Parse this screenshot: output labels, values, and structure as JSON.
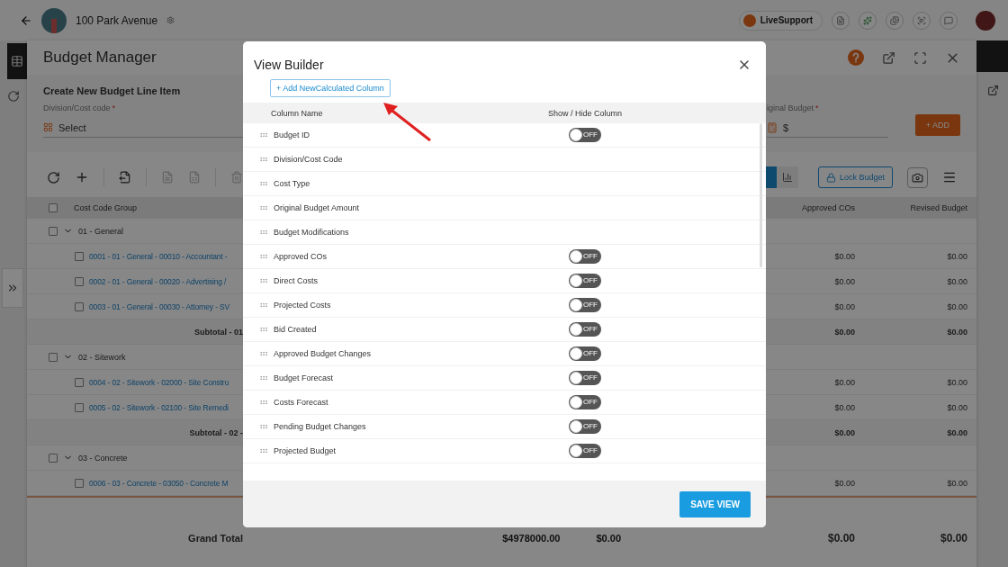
{
  "top_bar": {
    "project": "100 Park Avenue",
    "live_support": "LiveSupport"
  },
  "panel": {
    "title": "Budget Manager"
  },
  "create_form": {
    "title": "Create New Budget Line Item",
    "division_label": "Division/Cost code",
    "division_required": "*",
    "division_placeholder": "Select",
    "budget_label": "iginal Budget",
    "budget_required": "*",
    "budget_prefix": "$",
    "add_button": "+ ADD"
  },
  "toolbar": {
    "lock_button": "Lock Budget"
  },
  "table": {
    "select_all_checked": false,
    "columns": [
      "Cost Code Group",
      "Approved COs",
      "Revised Budget"
    ],
    "rows": [
      {
        "kind": "group",
        "label": "01 - General",
        "checked": false,
        "expanded": true
      },
      {
        "kind": "item",
        "label": "0001 - 01 - General - 00010 - Accountant -",
        "checked": false,
        "values": [
          "$0.00",
          "$0.00"
        ]
      },
      {
        "kind": "item",
        "label": "0002 - 01 - General - 00020 - Advertising /",
        "checked": false,
        "values": [
          "$0.00",
          "$0.00"
        ]
      },
      {
        "kind": "item",
        "label": "0003 - 01 - General - 00030 - Attorney - SV",
        "checked": false,
        "values": [
          "$0.00",
          "$0.00"
        ]
      },
      {
        "kind": "subtotal",
        "label": "Subtotal - 01",
        "values": [
          "$0.00",
          "$0.00"
        ]
      },
      {
        "kind": "group",
        "label": "02 - Sitework",
        "checked": false,
        "expanded": true
      },
      {
        "kind": "item",
        "label": "0004 - 02 - Sitework - 02000 - Site Constru",
        "checked": false,
        "values": [
          "$0.00",
          "$0.00"
        ]
      },
      {
        "kind": "item",
        "label": "0005 - 02 - Sitework - 02100 - Site Remedi",
        "checked": false,
        "values": [
          "$0.00",
          "$0.00"
        ]
      },
      {
        "kind": "subtotal",
        "label": "Subtotal - 02 -",
        "values": [
          "$0.00",
          "$0.00"
        ]
      },
      {
        "kind": "group",
        "label": "03 - Concrete",
        "checked": false,
        "expanded": true
      },
      {
        "kind": "item",
        "label": "0006 - 03 - Concrete - 03050 - Concrete M",
        "checked": false,
        "values": [
          "$0.00",
          "$0.00"
        ]
      }
    ],
    "grand_total": {
      "label": "Grand Total",
      "middle_values": [
        "$4978000.00",
        "$0.00"
      ],
      "values": [
        "$0.00",
        "$0.00"
      ]
    }
  },
  "dialog": {
    "title": "View Builder",
    "add_button": "+ Add NewCalculated Column",
    "headers": [
      "Column Name",
      "Show / Hide Column"
    ],
    "columns": [
      {
        "name": "Budget ID",
        "toggle": {
          "on": false,
          "label": "OFF"
        }
      },
      {
        "name": "Division/Cost Code"
      },
      {
        "name": "Cost Type"
      },
      {
        "name": "Original Budget Amount"
      },
      {
        "name": "Budget Modifications"
      },
      {
        "name": "Approved COs",
        "toggle": {
          "on": false,
          "label": "OFF"
        }
      },
      {
        "name": "Direct Costs",
        "toggle": {
          "on": false,
          "label": "OFF"
        }
      },
      {
        "name": "Projected Costs",
        "toggle": {
          "on": false,
          "label": "OFF"
        }
      },
      {
        "name": "Bid Created",
        "toggle": {
          "on": false,
          "label": "OFF"
        }
      },
      {
        "name": "Approved Budget Changes",
        "toggle": {
          "on": false,
          "label": "OFF"
        }
      },
      {
        "name": "Budget Forecast",
        "toggle": {
          "on": false,
          "label": "OFF"
        }
      },
      {
        "name": "Costs Forecast",
        "toggle": {
          "on": false,
          "label": "OFF"
        }
      },
      {
        "name": "Pending Budget Changes",
        "toggle": {
          "on": false,
          "label": "OFF"
        }
      },
      {
        "name": "Projected Budget",
        "toggle": {
          "on": false,
          "label": "OFF"
        }
      }
    ],
    "save_button": "SAVE VIEW"
  }
}
